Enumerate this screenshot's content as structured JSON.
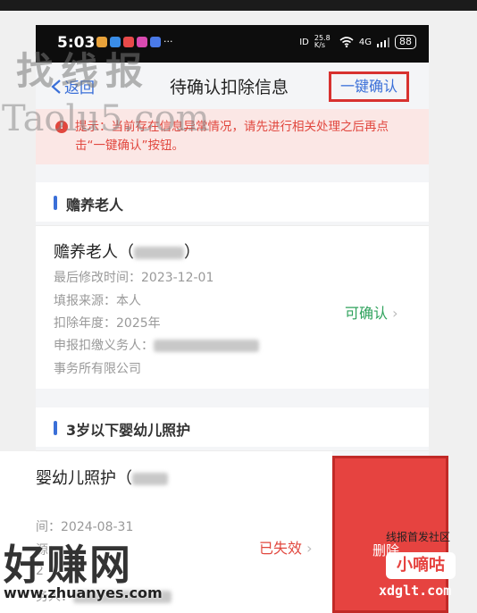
{
  "status_bar": {
    "time": "5:03",
    "signal_left": "ID",
    "speed": "25.8 K/s",
    "network": "4G",
    "battery": "88"
  },
  "nav": {
    "back_label": "返回",
    "title": "待确认扣除信息",
    "confirm_all_label": "一键确认"
  },
  "alert": {
    "text": "提示：当前存在信息异常情况，请先进行相关处理之后再点击“一键确认”按钮。"
  },
  "sections": [
    {
      "title": "赡养老人",
      "entries": [
        {
          "name": "赡养老人（",
          "name_suffix": "）",
          "last_modified": "最后修改时间：2023-12-01",
          "source": "填报来源：本人",
          "year": "扣除年度：2025年",
          "agent_label": "申报扣缴义务人：",
          "agent_tail": "事务所有限公司",
          "status": "可确认"
        }
      ]
    },
    {
      "title": "3岁以下婴幼儿照护",
      "entries": [
        {
          "name": "婴幼儿照护（",
          "last_modified": "间：2024-08-31",
          "row2": "源：",
          "row3": "2",
          "row4": "务人：",
          "status": "已失效",
          "delete_label": "删除"
        }
      ]
    }
  ],
  "watermarks": {
    "top_left_cn": "找线报",
    "top_left_en": "Taolu5.com",
    "bottom_left_cn": "好赚网",
    "bottom_left_url": "www.zhuanyes.com",
    "bottom_right_top": "线报首发社区",
    "bottom_right_badge": "小嘀咕",
    "bottom_right_url": "xdglt.com"
  },
  "colors": {
    "accent": "#3a6fd8",
    "warning": "#e1473e",
    "confirm_green": "#2fa25c",
    "delete_red": "#e64340"
  }
}
